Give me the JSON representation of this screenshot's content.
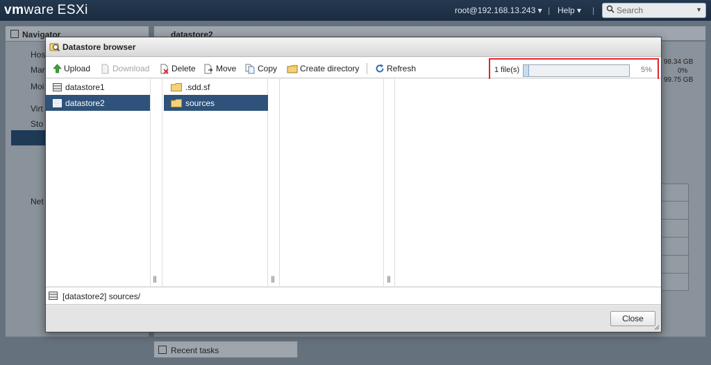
{
  "topbar": {
    "brand_vm": "vm",
    "brand_ware": "ware",
    "brand_esxi": "ESXi",
    "user": "root@192.168.13.243 ▾",
    "separator": "|",
    "help": "Help ▾",
    "search_placeholder": "Search"
  },
  "background": {
    "navigator_title": "Navigator",
    "nav_items": [
      "Hos",
      "Mar",
      "Moi",
      "Virt",
      "Sto",
      "Net"
    ],
    "main_title": "datastore2",
    "stats": [
      "98.34 GB",
      "0%",
      "99.75 GB"
    ],
    "recent_tasks": "Recent tasks"
  },
  "dialog": {
    "title": "Datastore browser",
    "toolbar": {
      "upload": "Upload",
      "download": "Download",
      "delete": "Delete",
      "move": "Move",
      "copy": "Copy",
      "create_directory": "Create directory",
      "refresh": "Refresh"
    },
    "upload_status": {
      "count": "1 file(s)",
      "percent_label": "5%",
      "progress": 0.05
    },
    "datastores": [
      {
        "name": "datastore1",
        "selected": false
      },
      {
        "name": "datastore2",
        "selected": true
      }
    ],
    "folders": [
      {
        "name": ".sdd.sf",
        "selected": false
      },
      {
        "name": "sources",
        "selected": true
      }
    ],
    "path": "[datastore2] sources/",
    "close_label": "Close"
  },
  "colors": {
    "selection": "#2e527a",
    "highlight_border": "#e0242b",
    "progress_fill": "#c8dcef"
  }
}
